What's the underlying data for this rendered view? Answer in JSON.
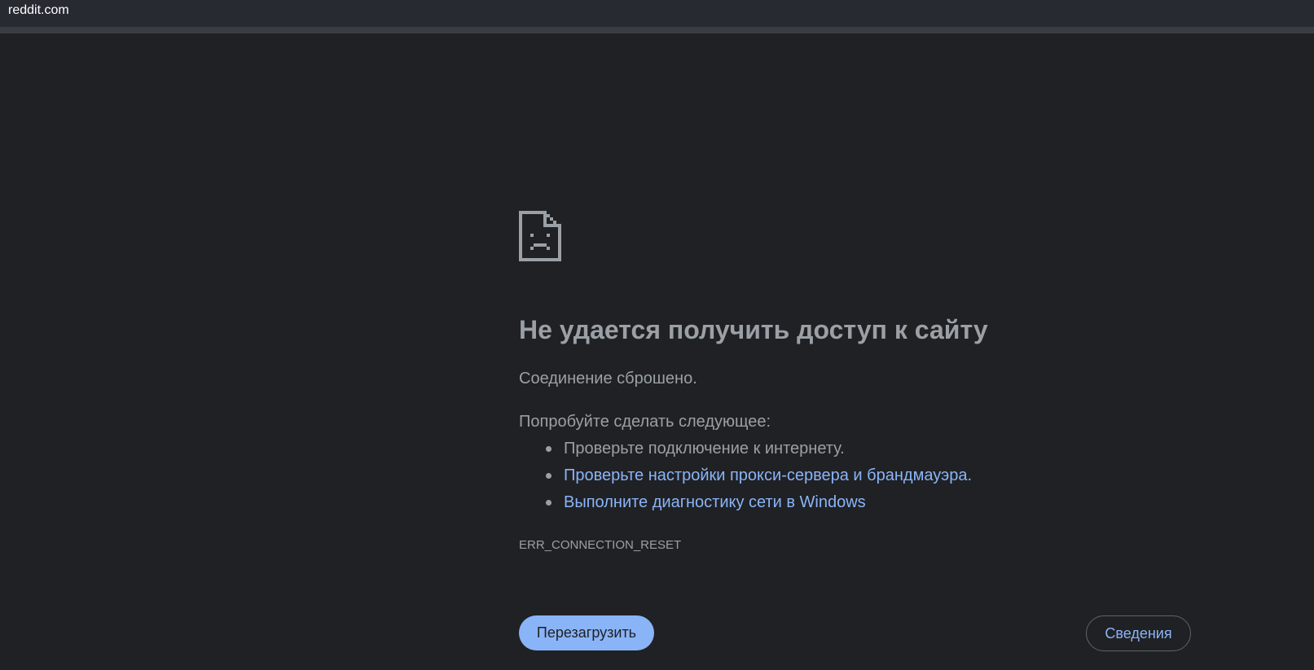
{
  "topbar": {
    "title": "reddit.com"
  },
  "error": {
    "icon": "sad-page-icon",
    "title": "Не удается получить доступ к сайту",
    "subtitle": "Соединение сброшено.",
    "try_heading": "Попробуйте сделать следующее:",
    "suggestions": [
      "Проверьте подключение к интернету.",
      "Проверьте настройки прокси-сервера и брандмауэра.",
      "Выполните диагностику сети в Windows"
    ],
    "code": "ERR_CONNECTION_RESET"
  },
  "buttons": {
    "reload_label": "Перезагрузить",
    "details_label": "Сведения"
  },
  "colors": {
    "background": "#202124",
    "text": "#9aa0a6",
    "link": "#8ab4f8",
    "button_bg": "#8ab4f8",
    "topbar": "#272a31"
  }
}
